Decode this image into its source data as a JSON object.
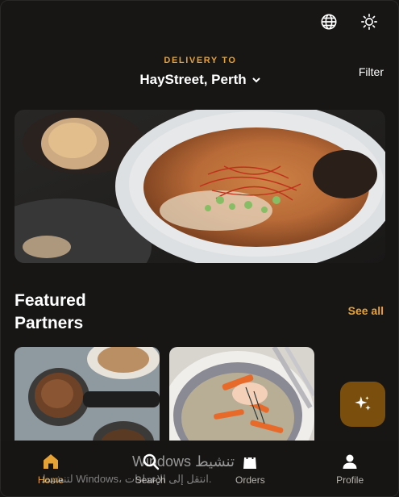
{
  "header": {
    "language_icon": "globe-icon",
    "theme_icon": "sun-icon"
  },
  "delivery": {
    "label": "DELIVERY TO",
    "location": "HayStreet, Perth",
    "chevron_icon": "chevron-down-icon"
  },
  "filter_label": "Filter",
  "featured": {
    "title": "Featured Partners",
    "see_all": "See all"
  },
  "fab_icon": "sparkle-icon",
  "nav": {
    "items": [
      {
        "label": "Home",
        "icon": "home-icon",
        "active": true
      },
      {
        "label": "Search",
        "icon": "search-icon",
        "active": false
      },
      {
        "label": "Orders",
        "icon": "bag-icon",
        "active": false
      },
      {
        "label": "Profile",
        "icon": "person-icon",
        "active": false
      }
    ]
  },
  "watermark": {
    "line1": "Windows تنشيط",
    "line2": "لتنشيط Windows، انتقل إلى الإعدادات."
  },
  "colors": {
    "accent": "#e6a235",
    "background": "#171615",
    "fab": "#7a4f0d"
  }
}
